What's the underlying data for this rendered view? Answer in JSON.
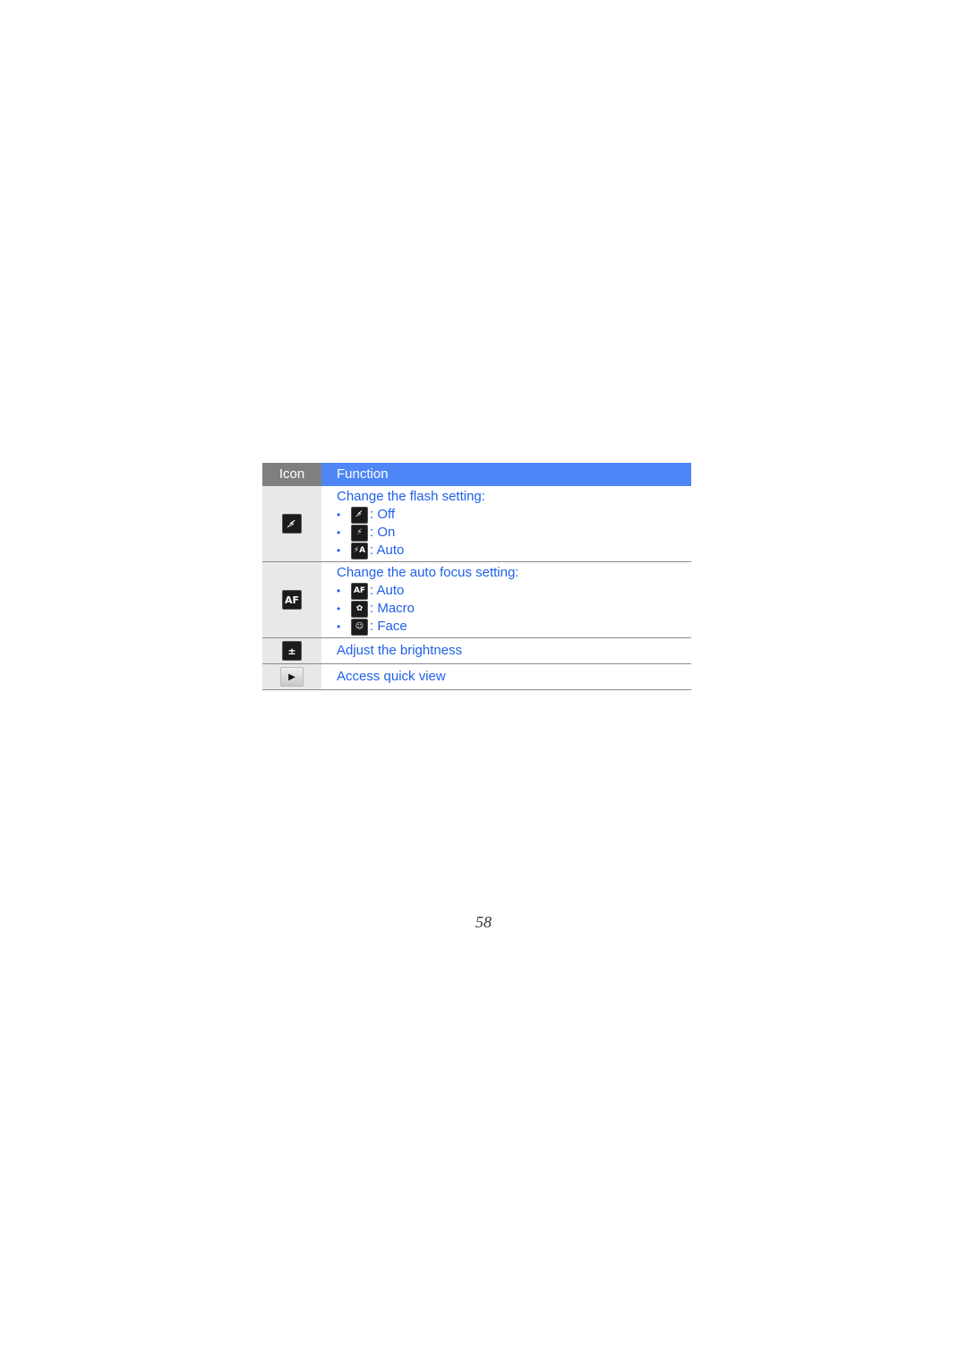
{
  "table": {
    "headers": {
      "icon": "Icon",
      "function": "Function"
    },
    "rows": [
      {
        "icon": "flash-off-icon",
        "title": "Change the flash setting:",
        "options": [
          {
            "icon": "flash-off-icon",
            "glyph": "⚡̸",
            "label": ": Off"
          },
          {
            "icon": "flash-on-icon",
            "glyph": "⚡",
            "label": ": On"
          },
          {
            "icon": "flash-auto-icon",
            "glyph": "⚡A",
            "label": ": Auto"
          }
        ]
      },
      {
        "icon": "auto-focus-icon",
        "title": "Change the auto focus setting:",
        "options": [
          {
            "icon": "auto-focus-icon",
            "glyph": "AF",
            "label": ": Auto"
          },
          {
            "icon": "macro-icon",
            "glyph": "✿",
            "label": ": Macro"
          },
          {
            "icon": "face-detect-icon",
            "glyph": "☺",
            "label": ": Face"
          }
        ]
      },
      {
        "icon": "brightness-icon",
        "glyph": "±",
        "title": "Adjust the brightness"
      },
      {
        "icon": "play-icon",
        "glyph": "▶",
        "title": "Access quick view"
      }
    ],
    "icon_glyphs": {
      "flash_off": "⚡̸",
      "auto_focus": "AF",
      "brightness": "±",
      "play": "▶"
    }
  },
  "bullet": "•",
  "page_number": "58",
  "colors": {
    "header_icon_bg": "#7f7f7f",
    "header_function_bg": "#4f86f7",
    "text_blue": "#2060e8",
    "icon_col_bg": "#e8e8e8"
  }
}
